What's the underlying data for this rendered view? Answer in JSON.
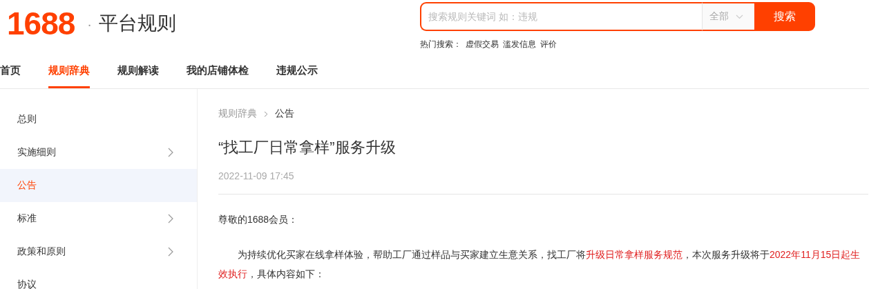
{
  "header": {
    "logo": "1688",
    "separator": "·",
    "title": "平台规则"
  },
  "search": {
    "placeholder": "搜索规则关键词 如：违规",
    "scope": "全部",
    "button": "搜索"
  },
  "hot_searches": {
    "label": "热门搜索：",
    "terms": [
      "虚假交易",
      "滥发信息",
      "评价"
    ]
  },
  "nav": [
    {
      "label": "首页",
      "selected": false
    },
    {
      "label": "规则辞典",
      "selected": true
    },
    {
      "label": "规则解读",
      "selected": false
    },
    {
      "label": "我的店铺体检",
      "selected": false
    },
    {
      "label": "违规公示",
      "selected": false
    }
  ],
  "sidebar": {
    "items": [
      {
        "label": "总则",
        "selected": false,
        "expandable": false
      },
      {
        "label": "实施细则",
        "selected": false,
        "expandable": true
      },
      {
        "label": "公告",
        "selected": true,
        "expandable": false
      },
      {
        "label": "标准",
        "selected": false,
        "expandable": true
      },
      {
        "label": "政策和原则",
        "selected": false,
        "expandable": true
      },
      {
        "label": "协议",
        "selected": false,
        "expandable": false
      }
    ]
  },
  "breadcrumb": [
    "规则辞典",
    "公告"
  ],
  "article": {
    "title": "“找工厂日常拿样”服务升级",
    "date": "2022-11-09 17:45",
    "greeting": "尊敬的1688会员：",
    "paragraph": [
      {
        "text": "为持续优化买家在线拿样体验，帮助工厂通过样品与买家建立生意关系，找工厂将",
        "highlight": false
      },
      {
        "text": "升级日常拿样服务规范",
        "highlight": true
      },
      {
        "text": "，本次服务升级将于",
        "highlight": false
      },
      {
        "text": "2022年11月15日起生效执行",
        "highlight": true
      },
      {
        "text": "，具体内容如下：",
        "highlight": false
      }
    ]
  }
}
